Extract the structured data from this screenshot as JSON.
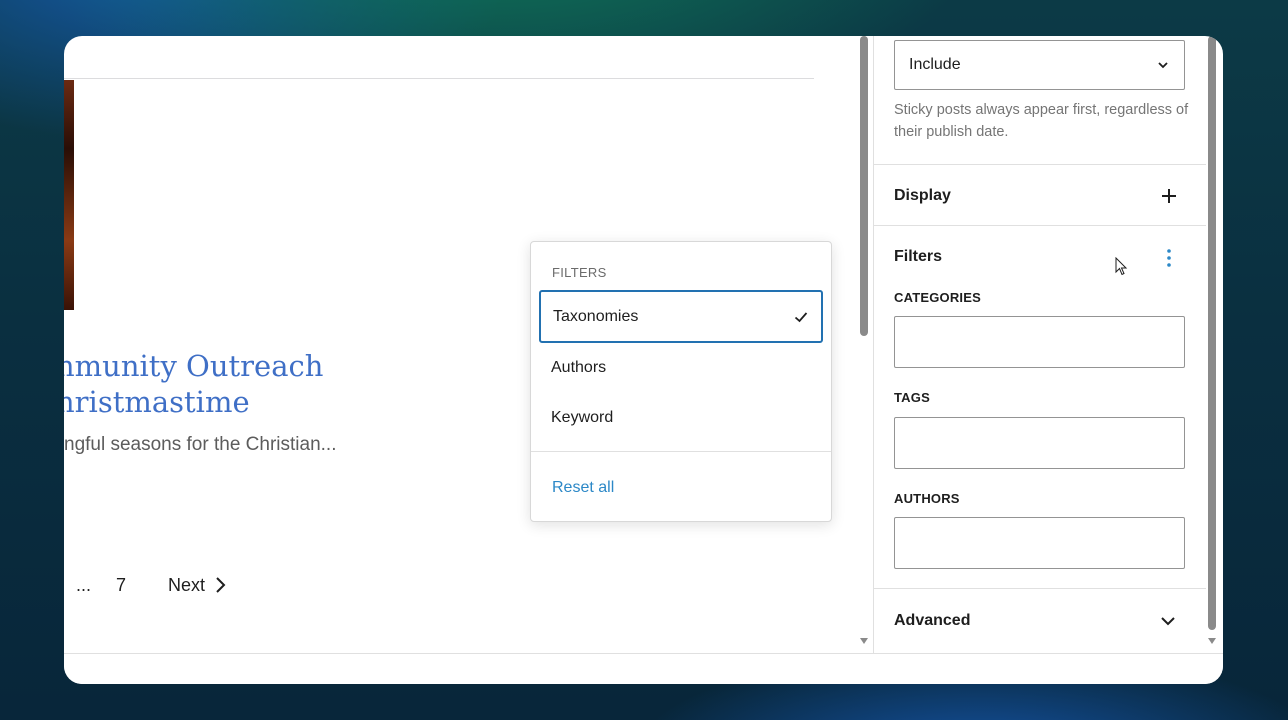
{
  "canvas": {
    "post_title_line1": "nmunity Outreach",
    "post_title_line2": "hristmastime",
    "post_excerpt": "ngful seasons for the Christian...",
    "pagination": {
      "ellipsis": "...",
      "last_page": "7",
      "next_label": "Next"
    }
  },
  "filters_menu": {
    "heading": "FILTERS",
    "items": [
      {
        "label": "Taxonomies",
        "checked": true
      },
      {
        "label": "Authors",
        "checked": false
      },
      {
        "label": "Keyword",
        "checked": false
      }
    ],
    "reset_label": "Reset all"
  },
  "sidebar": {
    "sticky_select_value": "Include",
    "sticky_help": "Sticky posts always appear first, regardless of their publish date.",
    "display_title": "Display",
    "filters_title": "Filters",
    "fields": [
      {
        "label": "CATEGORIES"
      },
      {
        "label": "TAGS"
      },
      {
        "label": "AUTHORS"
      }
    ],
    "advanced_title": "Advanced"
  },
  "colors": {
    "link_blue": "#2c88c7",
    "focus_blue": "#2271b1",
    "title_blue": "#3f6fc6"
  }
}
